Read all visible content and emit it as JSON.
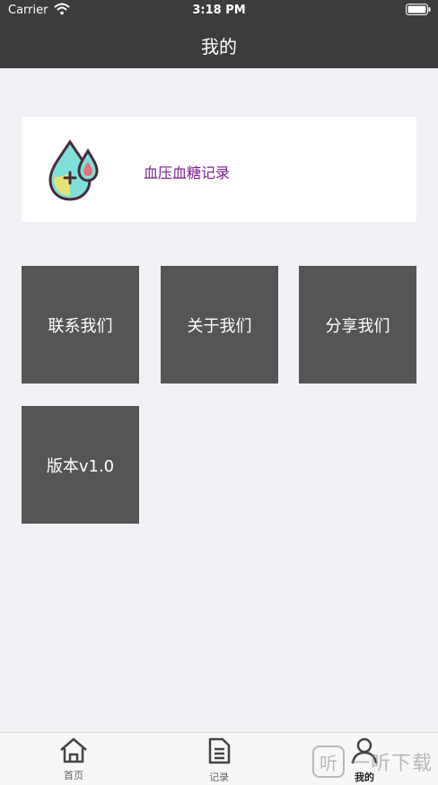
{
  "status": {
    "carrier": "Carrier",
    "time": "3:18 PM"
  },
  "nav": {
    "title": "我的"
  },
  "record_card": {
    "label": "血压血糖记录",
    "icon": "drop-medical-icon"
  },
  "tiles": [
    {
      "label": "联系我们"
    },
    {
      "label": "关于我们"
    },
    {
      "label": "分享我们"
    },
    {
      "label": "版本v1.0"
    }
  ],
  "tabbar": {
    "items": [
      {
        "label": "首页",
        "icon": "home-icon"
      },
      {
        "label": "记录",
        "icon": "document-icon"
      },
      {
        "label": "我的",
        "icon": "person-icon",
        "active": true
      }
    ]
  },
  "watermark": {
    "text": "一听下载",
    "glyph": "听"
  },
  "colors": {
    "header": "#3c3c3c",
    "tile": "#555555",
    "accent_text": "#7a1f8c",
    "background": "#f2f1f6"
  }
}
